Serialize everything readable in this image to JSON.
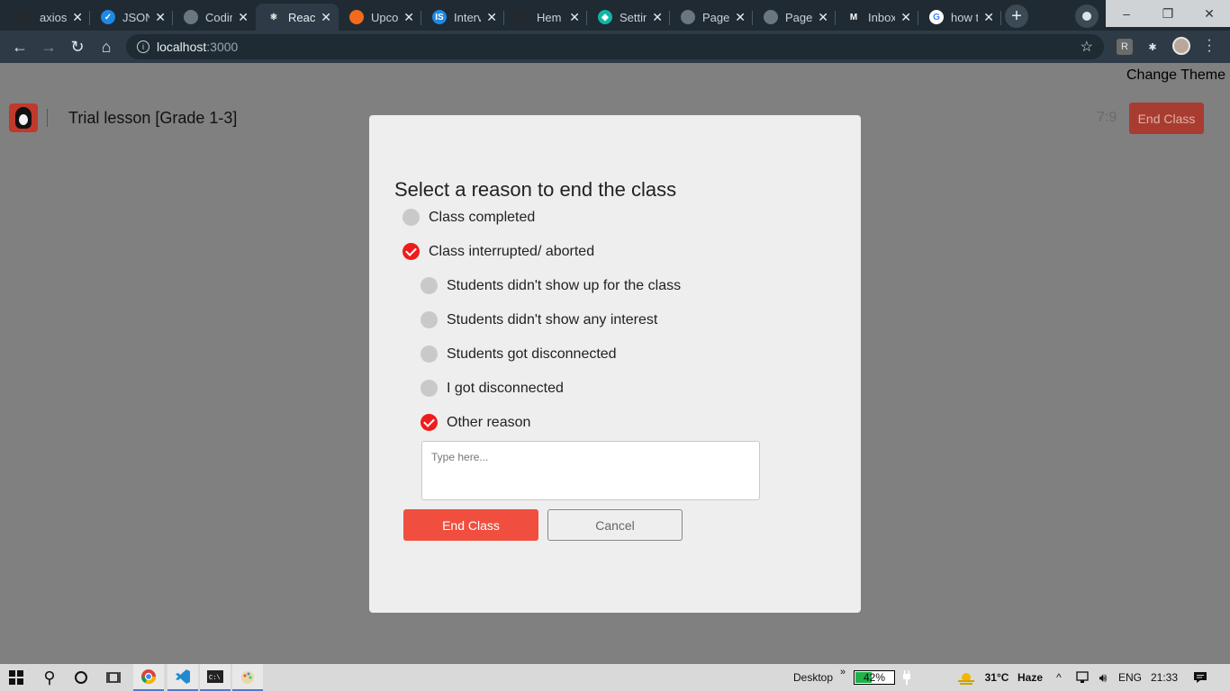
{
  "browser": {
    "tabs": [
      {
        "label": "axios",
        "icon": "github-icon",
        "fav_color": "#24292e",
        "fav_text": ""
      },
      {
        "label": "JSON",
        "icon": "check-icon",
        "fav_color": "#1e88e5",
        "fav_text": "✓"
      },
      {
        "label": "Codin",
        "icon": "globe-icon",
        "fav_color": "#6b7780",
        "fav_text": ""
      },
      {
        "label": "React",
        "icon": "react-icon",
        "fav_color": "#2e3b46",
        "fav_text": "⚛"
      },
      {
        "label": "Upco",
        "icon": "orange-circle-icon",
        "fav_color": "#f26a1b",
        "fav_text": ""
      },
      {
        "label": "Interv",
        "icon": "is-icon",
        "fav_color": "#1e88e5",
        "fav_text": "IS"
      },
      {
        "label": "Hem",
        "icon": "github-icon",
        "fav_color": "#24292e",
        "fav_text": ""
      },
      {
        "label": "Settin",
        "icon": "diamond-icon",
        "fav_color": "#12b5a5",
        "fav_text": "◆"
      },
      {
        "label": "Page",
        "icon": "globe-icon",
        "fav_color": "#6b7780",
        "fav_text": ""
      },
      {
        "label": "Page",
        "icon": "globe-icon",
        "fav_color": "#6b7780",
        "fav_text": ""
      },
      {
        "label": "Inbox",
        "icon": "mail-icon",
        "fav_color": "#1f2a33",
        "fav_text": "M"
      },
      {
        "label": "how t",
        "icon": "google-icon",
        "fav_color": "#ffffff",
        "fav_text": "G"
      }
    ],
    "url_host": "localhost",
    "url_port": ":3000",
    "new_tab": "+",
    "minimize": "–",
    "maximize": "❐",
    "close": "✕"
  },
  "page": {
    "change_theme": "Change Theme",
    "lesson_title": "Trial lesson [Grade 1-3]",
    "timer": "7:9",
    "end_class_top": "End Class"
  },
  "modal": {
    "title": "Select a reason to end the class",
    "options": [
      {
        "label": "Class completed",
        "checked": false
      },
      {
        "label": "Class interrupted/ aborted",
        "checked": true
      }
    ],
    "sub_options": [
      {
        "label": "Students didn't show up for the class",
        "checked": false
      },
      {
        "label": "Students didn't show any interest",
        "checked": false
      },
      {
        "label": "Students got disconnected",
        "checked": false
      },
      {
        "label": "I got disconnected",
        "checked": false
      },
      {
        "label": "Other reason",
        "checked": true
      }
    ],
    "textarea_placeholder": "Type here...",
    "end_button": "End Class",
    "cancel_button": "Cancel",
    "accent_color": "#ee1c1c"
  },
  "taskbar": {
    "desktop_label": "Desktop",
    "overflow": "»",
    "battery_percent": 42,
    "battery_label": "42%",
    "temperature": "31°C",
    "weather": "Haze",
    "language": "ENG",
    "time": "21:33"
  }
}
